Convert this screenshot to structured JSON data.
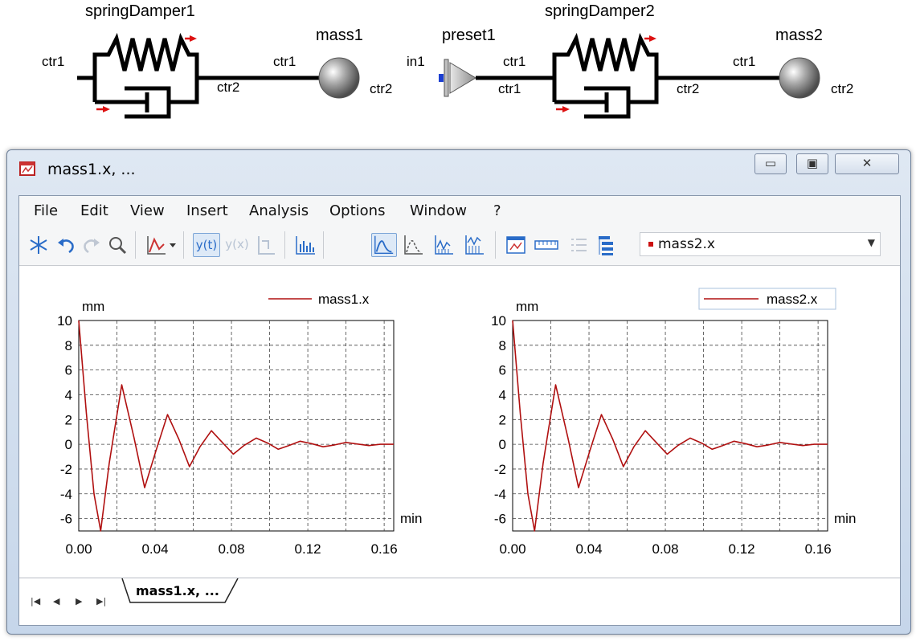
{
  "diagram": {
    "components": [
      {
        "name": "springDamper1",
        "port_left": "ctr1",
        "port_right": "ctr2"
      },
      {
        "name": "mass1",
        "port_left": "ctr1",
        "port_right": "ctr2"
      },
      {
        "name": "preset1",
        "port_left": "in1",
        "port_right": "ctr1"
      },
      {
        "name": "springDamper2",
        "port_left": "ctr1",
        "port_right": "ctr2"
      },
      {
        "name": "mass2",
        "port_left": "ctr1",
        "port_right": "ctr2"
      }
    ]
  },
  "window": {
    "title": "mass1.x, ...",
    "menu": [
      "File",
      "Edit",
      "View",
      "Insert",
      "Analysis",
      "Options",
      "Window",
      "?"
    ],
    "toolbar": {
      "icons": [
        "snowflake-icon",
        "undo-icon",
        "redo-icon",
        "zoom-icon",
        "curve-style-icon",
        "dropdown-arrow-icon",
        "yt-plot-icon",
        "yx-plot-icon",
        "add-axis-icon",
        "bar-chart-icon",
        "plot-mode-1-icon",
        "plot-mode-2-icon",
        "plot-mode-3-icon",
        "plot-mode-4-icon",
        "window-icon",
        "ruler-icon",
        "list-icon",
        "tree-icon"
      ],
      "yt_label": "y(t)",
      "yx_label": "y(x)",
      "combo_value": "mass2.x",
      "combo_color": "#cc1111"
    },
    "tab": {
      "label": "mass1.x, ..."
    }
  },
  "chart_data": [
    {
      "type": "line",
      "ylabel": "mm",
      "xlabel": "min",
      "xlim": [
        0,
        0.165
      ],
      "ylim": [
        -7,
        10
      ],
      "xticks": [
        "0.00",
        "0.04",
        "0.08",
        "0.12",
        "0.16"
      ],
      "yticks": [
        "10",
        "8",
        "6",
        "4",
        "2",
        "0",
        "-2",
        "-4",
        "-6"
      ],
      "grid": true,
      "legend_position": "top-right",
      "series": [
        {
          "name": "mass1.x",
          "color": "#b01010",
          "x": [
            0,
            0.004,
            0.008,
            0.0115,
            0.016,
            0.0225,
            0.029,
            0.0345,
            0.0405,
            0.0465,
            0.0525,
            0.058,
            0.0635,
            0.0695,
            0.0755,
            0.081,
            0.0865,
            0.093,
            0.099,
            0.1045,
            0.11,
            0.116,
            0.122,
            0.128,
            0.134,
            0.14,
            0.146,
            0.152,
            0.158,
            0.165
          ],
          "y": [
            10,
            2.5,
            -4,
            -7,
            -1.5,
            4.8,
            0.5,
            -3.5,
            -0.5,
            2.4,
            0.4,
            -1.8,
            -0.2,
            1.1,
            0.1,
            -0.8,
            -0.1,
            0.5,
            0.1,
            -0.4,
            -0.1,
            0.25,
            0.05,
            -0.2,
            -0.05,
            0.15,
            0.02,
            -0.1,
            0,
            0
          ]
        }
      ]
    },
    {
      "type": "line",
      "ylabel": "mm",
      "xlabel": "min",
      "xlim": [
        0,
        0.165
      ],
      "ylim": [
        -7,
        10
      ],
      "xticks": [
        "0.00",
        "0.04",
        "0.08",
        "0.12",
        "0.16"
      ],
      "yticks": [
        "10",
        "8",
        "6",
        "4",
        "2",
        "0",
        "-2",
        "-4",
        "-6"
      ],
      "grid": true,
      "legend_position": "top-right",
      "series": [
        {
          "name": "mass2.x",
          "color": "#b01010",
          "x": [
            0,
            0.004,
            0.008,
            0.0115,
            0.016,
            0.0225,
            0.029,
            0.0345,
            0.0405,
            0.0465,
            0.0525,
            0.058,
            0.0635,
            0.0695,
            0.0755,
            0.081,
            0.0865,
            0.093,
            0.099,
            0.1045,
            0.11,
            0.116,
            0.122,
            0.128,
            0.134,
            0.14,
            0.146,
            0.152,
            0.158,
            0.165
          ],
          "y": [
            10,
            2.5,
            -4,
            -7,
            -1.5,
            4.8,
            0.5,
            -3.5,
            -0.5,
            2.4,
            0.4,
            -1.8,
            -0.2,
            1.1,
            0.1,
            -0.8,
            -0.1,
            0.5,
            0.1,
            -0.4,
            -0.1,
            0.25,
            0.05,
            -0.2,
            -0.05,
            0.15,
            0.02,
            -0.1,
            0,
            0
          ]
        }
      ]
    }
  ]
}
